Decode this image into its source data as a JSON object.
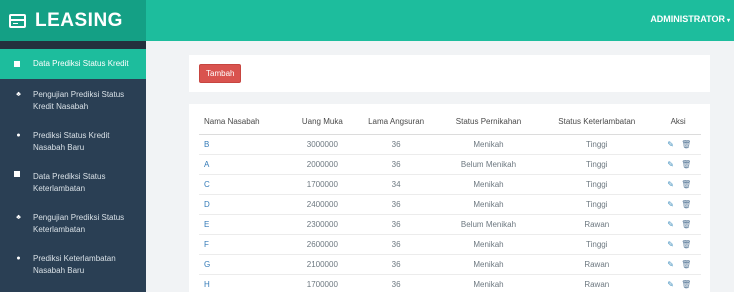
{
  "brand": {
    "title": "LEASING"
  },
  "header": {
    "user_label": "ADMINISTRATOR"
  },
  "sidebar": {
    "items": [
      {
        "label": "Data Prediksi Status Kredit",
        "icon": "square-icon",
        "active": true
      },
      {
        "label": "Pengujian Prediksi Status Kredit Nasabah",
        "icon": "sitemap-icon"
      },
      {
        "label": "Prediksi Status Kredit Nasabah Baru",
        "icon": "user-icon"
      },
      {
        "label": "Data Prediksi Status Keterlambatan",
        "icon": "square-icon"
      },
      {
        "label": "Pengujian Prediksi Status Keterlambatan",
        "icon": "sitemap-icon"
      },
      {
        "label": "Prediksi Keterlambatan Nasabah Baru",
        "icon": "user-icon"
      }
    ]
  },
  "toolbar": {
    "add_label": "Tambah"
  },
  "table": {
    "columns": [
      "Nama Nasabah",
      "Uang Muka",
      "Lama Angsuran",
      "Status Pernikahan",
      "Status Keterlambatan",
      "Aksi"
    ],
    "rows": [
      [
        "B",
        "3000000",
        "36",
        "Menikah",
        "Tinggi"
      ],
      [
        "A",
        "2000000",
        "36",
        "Belum Menikah",
        "Tinggi"
      ],
      [
        "C",
        "1700000",
        "34",
        "Menikah",
        "Tinggi"
      ],
      [
        "D",
        "2400000",
        "36",
        "Menikah",
        "Tinggi"
      ],
      [
        "E",
        "2300000",
        "36",
        "Belum Menikah",
        "Rawan"
      ],
      [
        "F",
        "2600000",
        "36",
        "Menikah",
        "Tinggi"
      ],
      [
        "G",
        "2100000",
        "36",
        "Menikah",
        "Rawan"
      ],
      [
        "H",
        "1700000",
        "36",
        "Menikah",
        "Rawan"
      ]
    ],
    "action_icons": [
      "edit-icon",
      "trash-icon"
    ]
  },
  "colors": {
    "accent": "#1dbd9d",
    "sidebar": "#2a3f54",
    "danger": "#d9534f",
    "link": "#337ab7"
  }
}
